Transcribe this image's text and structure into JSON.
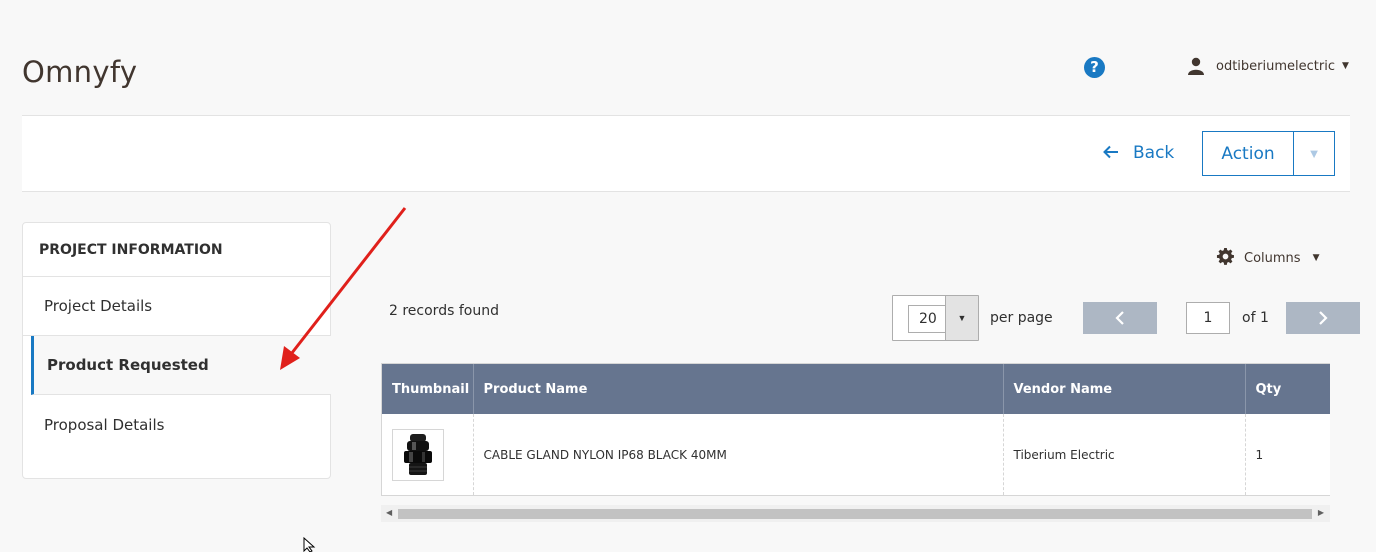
{
  "header": {
    "logo": "Omnyfy",
    "help_icon": "?",
    "username": "odtiberiumelectric"
  },
  "pagebar": {
    "back_label": "Back",
    "action_label": "Action"
  },
  "sidebar": {
    "title": "PROJECT INFORMATION",
    "items": [
      {
        "label": "Project Details",
        "active": false
      },
      {
        "label": "Product Requested",
        "active": true
      },
      {
        "label": "Proposal Details",
        "active": false
      }
    ]
  },
  "toolbar": {
    "columns_label": "Columns",
    "records_found": "2 records found",
    "per_page_value": "20",
    "per_page_label": "per page",
    "page_current": "1",
    "page_total_label": "of 1"
  },
  "grid": {
    "headers": [
      "Thumbnail",
      "Product Name",
      "Vendor Name",
      "Qty"
    ],
    "rows": [
      {
        "product_name": "CABLE GLAND NYLON IP68 BLACK 40MM",
        "vendor_name": "Tiberium Electric",
        "qty": "1"
      }
    ]
  },
  "colors": {
    "accent": "#1979c3",
    "grid_header": "#66758f",
    "pager_button": "#adb7c4",
    "annotation_arrow": "#e0201b"
  }
}
